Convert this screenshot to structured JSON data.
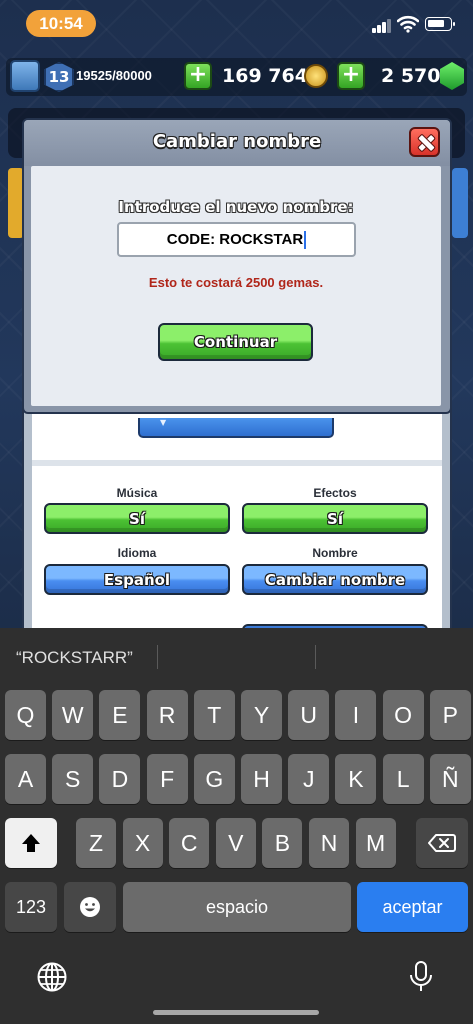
{
  "status_bar": {
    "time": "10:54"
  },
  "resources": {
    "level": "13",
    "xp": "19525/80000",
    "gold": "169 764",
    "gems": "2 570"
  },
  "dialog": {
    "title": "Cambiar nombre",
    "prompt": "Introduce el nuevo nombre:",
    "input_value": "CODE: ROCKSTAR",
    "cost_text": "Esto te costará 2500 gemas.",
    "continue_label": "Continuar"
  },
  "settings": {
    "music_label": "Música",
    "music_value": "Sí",
    "effects_label": "Efectos",
    "effects_value": "Sí",
    "language_label": "Idioma",
    "language_value": "Español",
    "name_label": "Nombre",
    "name_button": "Cambiar nombre"
  },
  "keyboard": {
    "suggestion": "“ROCKSTARR”",
    "row1": [
      "Q",
      "W",
      "E",
      "R",
      "T",
      "Y",
      "U",
      "I",
      "O",
      "P"
    ],
    "row2": [
      "A",
      "S",
      "D",
      "F",
      "G",
      "H",
      "J",
      "K",
      "L",
      "Ñ"
    ],
    "row3": [
      "Z",
      "X",
      "C",
      "V",
      "B",
      "N",
      "M"
    ],
    "numbers_key": "123",
    "space_key": "espacio",
    "return_key": "aceptar"
  },
  "colors": {
    "accent_green": "#4cc234",
    "accent_blue": "#4a8ef0",
    "close_red": "#d8322a",
    "return_blue": "#2a7ef0",
    "cost_red": "#b0261a"
  },
  "icons": [
    "signal-icon",
    "wifi-icon",
    "battery-icon",
    "crown-icon",
    "coin-icon",
    "gem-icon",
    "close-icon",
    "shift-icon",
    "backspace-icon",
    "emoji-icon",
    "globe-icon",
    "microphone-icon"
  ]
}
